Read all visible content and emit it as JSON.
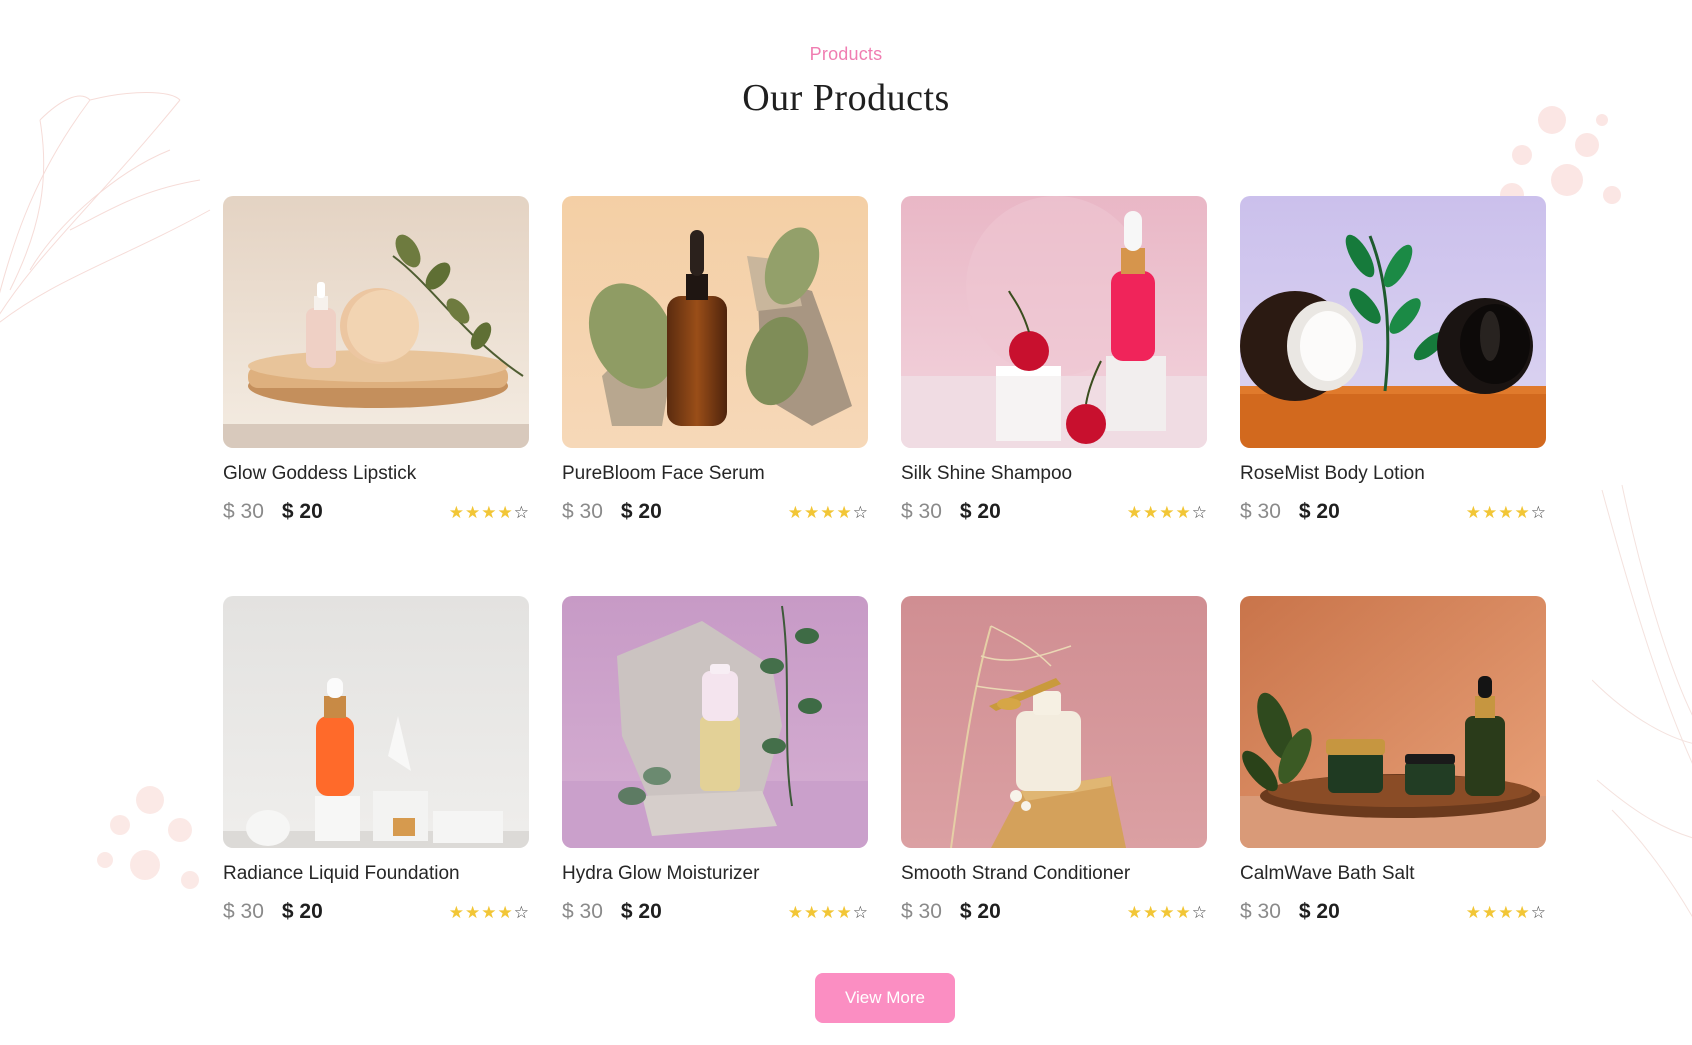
{
  "section": {
    "eyebrow": "Products",
    "title": "Our Products"
  },
  "colors": {
    "accent": "#f07db1",
    "button": "#fb8ec2",
    "star": "#f2c636"
  },
  "products": [
    {
      "name": "Glow Goddess Lipstick",
      "old_price": "$ 30",
      "price": "$ 20",
      "rating": 4,
      "rating_max": 5,
      "image_theme": "beige-wood-pedestal"
    },
    {
      "name": "PureBloom Face Serum",
      "old_price": "$ 30",
      "price": "$ 20",
      "rating": 4,
      "rating_max": 5,
      "image_theme": "peach-amber-bottle-rocks"
    },
    {
      "name": "Silk Shine Shampoo",
      "old_price": "$ 30",
      "price": "$ 20",
      "rating": 4,
      "rating_max": 5,
      "image_theme": "pink-cherries-dropper"
    },
    {
      "name": "RoseMist Body Lotion",
      "old_price": "$ 30",
      "price": "$ 20",
      "rating": 4,
      "rating_max": 5,
      "image_theme": "lavender-cream-jars"
    },
    {
      "name": "Radiance Liquid Foundation",
      "old_price": "$ 30",
      "price": "$ 20",
      "rating": 4,
      "rating_max": 5,
      "image_theme": "grey-orange-dropper"
    },
    {
      "name": "Hydra Glow Moisturizer",
      "old_price": "$ 30",
      "price": "$ 20",
      "rating": 4,
      "rating_max": 5,
      "image_theme": "purple-stone-bottle"
    },
    {
      "name": "Smooth Strand Conditioner",
      "old_price": "$ 30",
      "price": "$ 20",
      "rating": 4,
      "rating_max": 5,
      "image_theme": "rose-cream-bottle-wood"
    },
    {
      "name": "CalmWave Bath Salt",
      "old_price": "$ 30",
      "price": "$ 20",
      "rating": 4,
      "rating_max": 5,
      "image_theme": "terracotta-green-jars-tray"
    }
  ],
  "view_more": {
    "label": "View More"
  }
}
